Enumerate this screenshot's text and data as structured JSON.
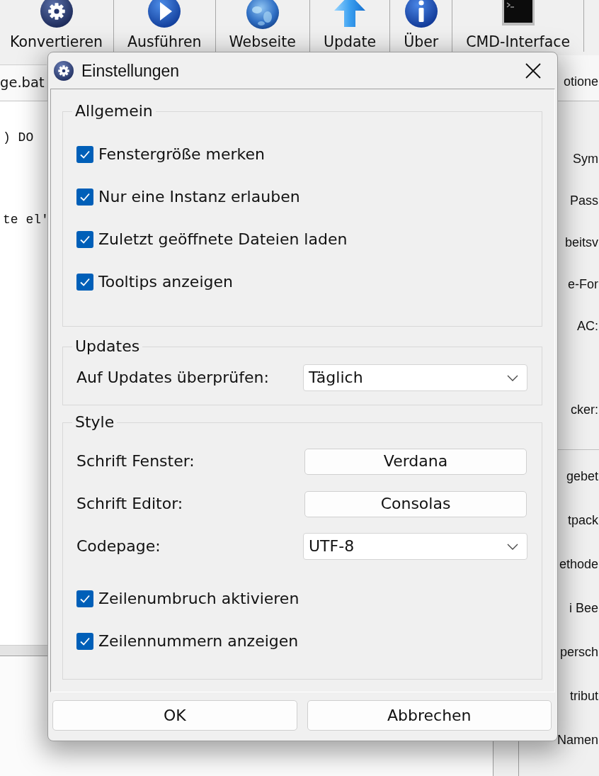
{
  "toolbar": [
    "Konvertieren",
    "Ausführen",
    "Webseite",
    "Update",
    "Über",
    "CMD-Interface"
  ],
  "editor": {
    "tab": "ge.bat",
    "lines": [
      ") DO",
      "te el'"
    ]
  },
  "side_panel": {
    "tab": "otione",
    "sections": [
      {
        "labels": [
          "Sym",
          "Pass",
          "beitsv",
          "e-For",
          "AC:",
          "cker:"
        ]
      },
      {
        "labels": [
          "gebet",
          "tpack",
          "ethode",
          "i Bee",
          "persch",
          "tribut",
          "Namen"
        ]
      }
    ]
  },
  "dialog": {
    "title": "Einstellungen",
    "groups": [
      {
        "title": "Allgemein",
        "items": [
          {
            "kind": "checkbox",
            "label": "Fenstergröße merken",
            "checked": true
          },
          {
            "kind": "checkbox",
            "label": "Nur eine Instanz erlauben",
            "checked": true
          },
          {
            "kind": "checkbox",
            "label": "Zuletzt geöffnete Dateien laden",
            "checked": true
          },
          {
            "kind": "checkbox",
            "label": "Tooltips anzeigen",
            "checked": true
          }
        ]
      },
      {
        "title": "Updates",
        "items": [
          {
            "kind": "select",
            "label": "Auf Updates überprüfen:",
            "value": "Täglich"
          }
        ]
      },
      {
        "title": "Style",
        "items": [
          {
            "kind": "button",
            "label": "Schrift Fenster:",
            "value": "Verdana"
          },
          {
            "kind": "button",
            "label": "Schrift Editor:",
            "value": "Consolas"
          },
          {
            "kind": "select",
            "label": "Codepage:",
            "value": "UTF-8"
          },
          {
            "kind": "checkbox",
            "label": "Zeilenumbruch aktivieren",
            "checked": true
          },
          {
            "kind": "checkbox",
            "label": "Zeilennummern anzeigen",
            "checked": true
          }
        ]
      }
    ],
    "buttons": [
      "OK",
      "Abbrechen"
    ]
  }
}
